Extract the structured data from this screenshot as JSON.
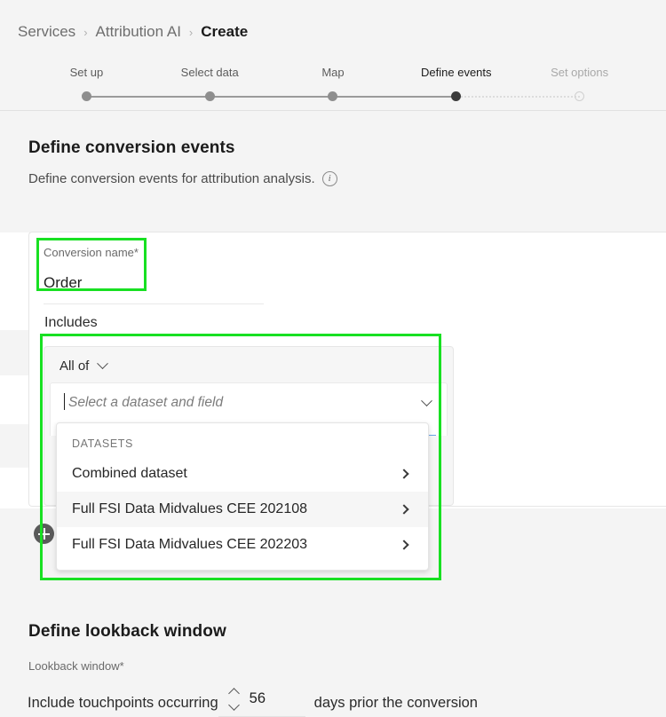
{
  "breadcrumb": {
    "items": [
      {
        "label": "Services",
        "current": false
      },
      {
        "label": "Attribution AI",
        "current": false
      },
      {
        "label": "Create",
        "current": true
      }
    ],
    "separator": "›"
  },
  "stepper": {
    "steps": [
      {
        "label": "Set up",
        "state": "complete"
      },
      {
        "label": "Select data",
        "state": "complete"
      },
      {
        "label": "Map",
        "state": "complete"
      },
      {
        "label": "Define events",
        "state": "active"
      },
      {
        "label": "Set options",
        "state": "disabled"
      }
    ]
  },
  "conversion_events": {
    "title": "Define conversion events",
    "description": "Define conversion events for attribution analysis.",
    "info_icon": "info-icon",
    "name_field": {
      "label": "Conversion name*",
      "value": "Order"
    },
    "includes_label": "Includes",
    "group": {
      "operator": "All of",
      "operator_icon": "chevron-down-icon",
      "combo_placeholder": "Select a dataset and field",
      "combo_icon": "chevron-down-icon",
      "combo_value": ""
    },
    "add_button_icon": "plus-icon"
  },
  "dropdown": {
    "section_title": "DATASETS",
    "items": [
      {
        "label": "Combined dataset",
        "hovered": false,
        "icon": "chevron-right-icon"
      },
      {
        "label": "Full FSI Data Midvalues CEE 202108",
        "hovered": true,
        "icon": "chevron-right-icon"
      },
      {
        "label": "Full FSI Data Midvalues CEE 202203",
        "hovered": false,
        "icon": "chevron-right-icon"
      }
    ]
  },
  "lookback": {
    "title": "Define lookback window",
    "label": "Lookback window*",
    "prefix_text": "Include touchpoints occurring",
    "value": "56",
    "suffix_text": "days prior the conversion",
    "stepper_up_icon": "chevron-up-icon",
    "stepper_down_icon": "chevron-down-icon"
  },
  "colors": {
    "highlight": "#18e022",
    "focus_underline": "#6aa3e8",
    "page_background": "#f4f4f4",
    "card_background": "#ffffff"
  }
}
